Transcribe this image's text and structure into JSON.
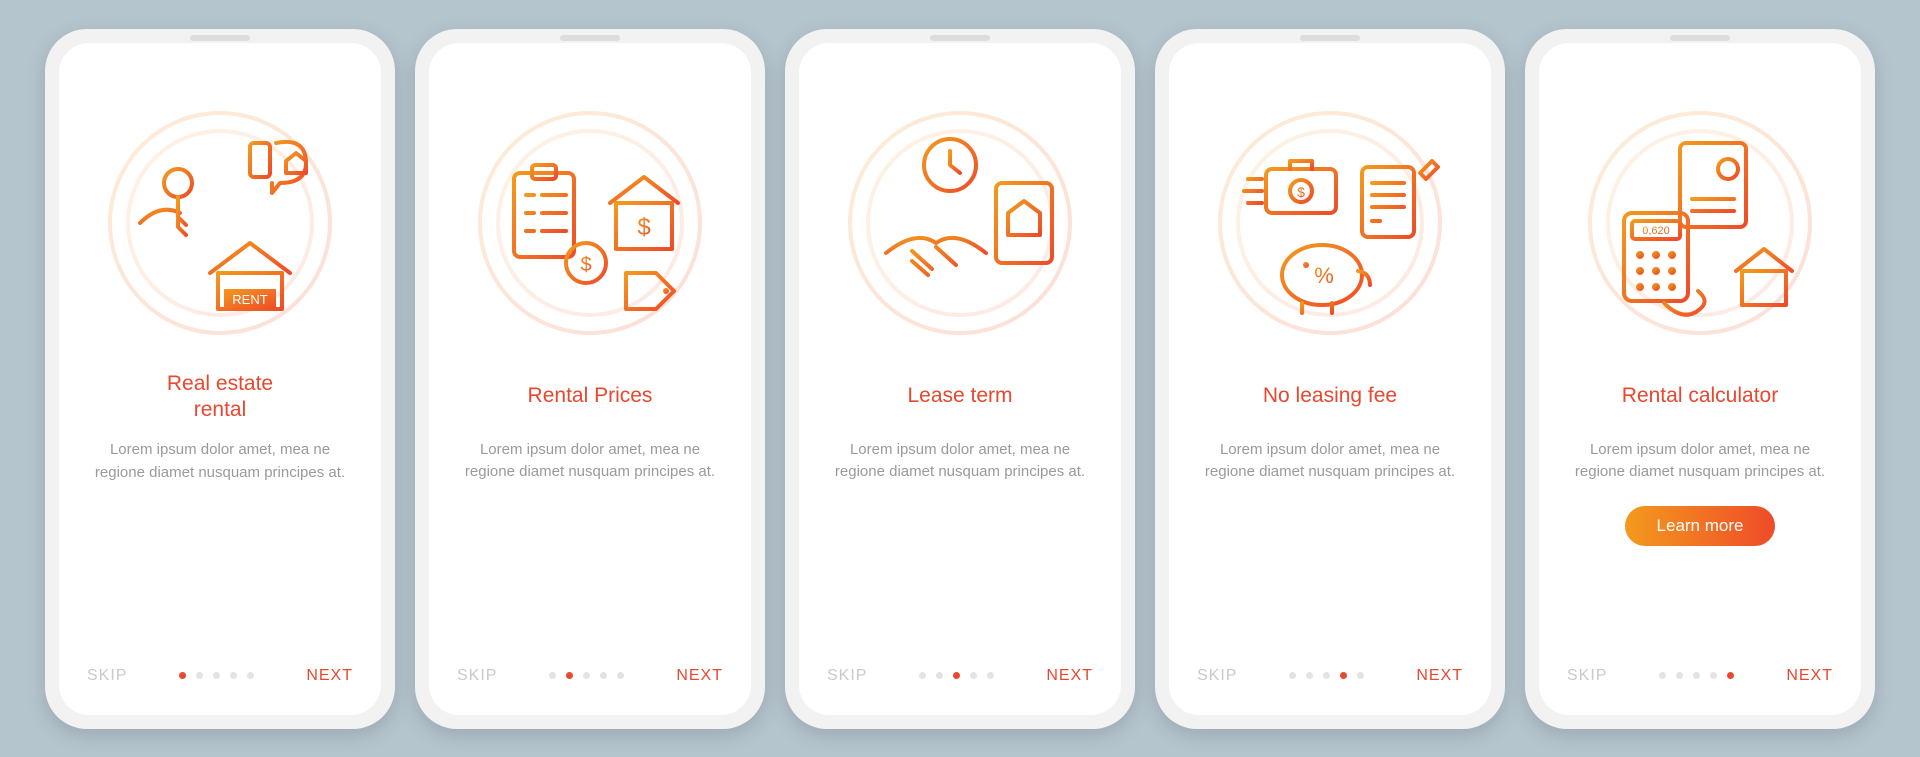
{
  "colors": {
    "accent": "#e8482f",
    "gradientA": "#f39a1e",
    "gradientB": "#ef4b28"
  },
  "common": {
    "skip_label": "SKIP",
    "next_label": "NEXT",
    "description": "Lorem ipsum dolor amet, mea ne regione diamet nusquam principes at.",
    "learn_more": "Learn more",
    "dot_count": 5
  },
  "screens": [
    {
      "title": "Real estate\nrental",
      "icon": "real-estate-rental-icon",
      "active_dot": 0,
      "has_learn_more": false,
      "illustration_elements": [
        "key-in-hand",
        "phone-with-house-bubble",
        "house-with-rent-sign"
      ],
      "rent_sign": "RENT"
    },
    {
      "title": "Rental Prices",
      "icon": "rental-prices-icon",
      "active_dot": 1,
      "has_learn_more": false,
      "illustration_elements": [
        "checklist-clipboard",
        "house-with-dollar",
        "coin",
        "price-tag"
      ]
    },
    {
      "title": "Lease term",
      "icon": "lease-term-icon",
      "active_dot": 2,
      "has_learn_more": false,
      "illustration_elements": [
        "clock",
        "handshake",
        "contract-with-house"
      ]
    },
    {
      "title": "No leasing fee",
      "icon": "no-leasing-fee-icon",
      "active_dot": 3,
      "has_learn_more": false,
      "illustration_elements": [
        "briefcase-with-coin",
        "document-with-pen",
        "piggy-bank-percent"
      ]
    },
    {
      "title": "Rental calculator",
      "icon": "rental-calculator-icon",
      "active_dot": 4,
      "has_learn_more": true,
      "calculator_display": "0,620",
      "illustration_elements": [
        "document-with-chart",
        "calculator-with-hand",
        "house"
      ]
    }
  ]
}
